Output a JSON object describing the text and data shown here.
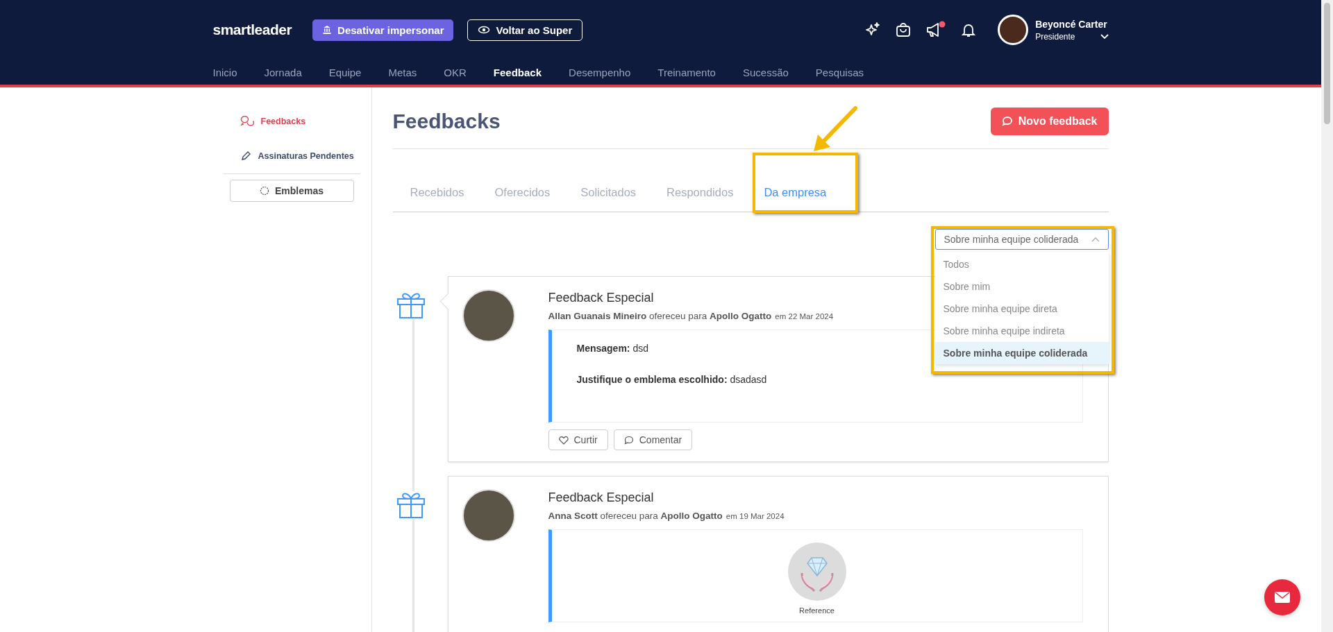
{
  "header": {
    "brand": "smartleader",
    "buttons": [
      "Desativar impersonar",
      "Voltar ao Super"
    ],
    "user": {
      "name": "Beyoncé Carter",
      "role": "Presidente"
    },
    "nav": [
      {
        "label": "Inicio",
        "selected": false
      },
      {
        "label": "Jornada",
        "selected": false
      },
      {
        "label": "Equipe",
        "selected": false
      },
      {
        "label": "Metas",
        "selected": false
      },
      {
        "label": "OKR",
        "selected": false
      },
      {
        "label": "Feedback",
        "selected": true
      },
      {
        "label": "Desempenho",
        "selected": false
      },
      {
        "label": "Treinamento",
        "selected": false
      },
      {
        "label": "Sucessão",
        "selected": false
      },
      {
        "label": "Pesquisas",
        "selected": false
      }
    ]
  },
  "sidebar": {
    "items": [
      {
        "label": "Feedbacks",
        "selected": true
      },
      {
        "label": "Assinaturas Pendentes",
        "selected": false
      }
    ],
    "button": "Emblemas"
  },
  "page": {
    "title": "Feedbacks",
    "new_button": "Novo feedback",
    "tabs": [
      {
        "label": "Recebidos",
        "selected": false
      },
      {
        "label": "Oferecidos",
        "selected": false
      },
      {
        "label": "Solicitados",
        "selected": false
      },
      {
        "label": "Respondidos",
        "selected": false
      },
      {
        "label": "Da empresa",
        "selected": true
      }
    ],
    "filter": {
      "value": "Sobre minha equipe coliderada",
      "expanded": true,
      "options": [
        {
          "label": "Todos",
          "selected": false
        },
        {
          "label": "Sobre mim",
          "selected": false
        },
        {
          "label": "Sobre minha equipe direta",
          "selected": false
        },
        {
          "label": "Sobre minha equipe indireta",
          "selected": false
        },
        {
          "label": "Sobre minha equipe coliderada",
          "selected": true
        }
      ]
    },
    "feedbacks": [
      {
        "title": "Feedback Especial",
        "byline": "**Allan Guanais Mineiro** ofereceu para **Apollo Ogatto**",
        "date": "em 22 Mar 2024",
        "kind": "message",
        "fields": [
          "**Mensagem:** dsd",
          "**Justifique o emblema escolhido:** dsadasd"
        ],
        "actions": [
          "Curtir",
          "Comentar"
        ]
      },
      {
        "title": "Feedback Especial",
        "byline": "**Anna Scott** ofereceu para **Apollo Ogatto**",
        "date": "em 19 Mar 2024",
        "kind": "badge",
        "badge": {
          "label": "Reference"
        }
      }
    ]
  }
}
